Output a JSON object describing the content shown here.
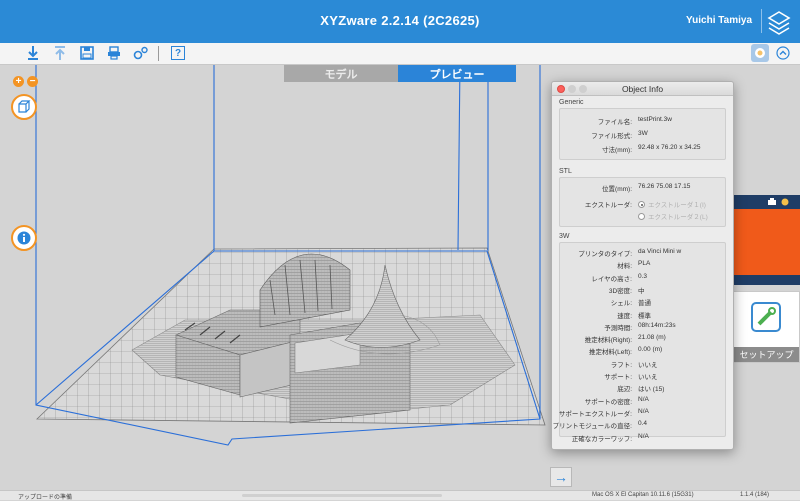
{
  "app": {
    "title": "XYZware 2.2.14 (2C2625)",
    "user_name": "Yuichi Tamiya"
  },
  "toolbar": {
    "buttons": [
      "import-icon",
      "export-icon",
      "save-icon",
      "print-icon",
      "settings-icon",
      "help-icon"
    ],
    "help_label": "?"
  },
  "colors": {
    "accent": "#2b8ad6",
    "orange": "#f39424",
    "panel_orange": "#f05a1a",
    "navy": "#1f3d66"
  },
  "mode_tabs": {
    "model": "モデル",
    "preview": "プレビュー",
    "active": "preview"
  },
  "zoom": {
    "plus": "+",
    "minus": "−"
  },
  "object_info": {
    "title": "Object Info",
    "generic": {
      "title": "Generic",
      "rows": [
        {
          "label": "ファイル名:",
          "value": "testPrint.3w"
        },
        {
          "label": "ファイル形式:",
          "value": "3W"
        },
        {
          "label": "寸法(mm):",
          "value": "92.48 x 76.20 x 34.25"
        }
      ]
    },
    "stl": {
      "title": "STL",
      "position_label": "位置(mm):",
      "position_value": "76.26  75.08  17.15",
      "extruder_label": "エクストルーダ:",
      "extruder_options": [
        "エクストルーダ１(I)",
        "エクストルーダ２(L)"
      ],
      "extruder_selected": 0
    },
    "w3": {
      "title": "3W",
      "rows": [
        {
          "label": "プリンタのタイプ:",
          "value": "da Vinci Mini w"
        },
        {
          "label": "材料:",
          "value": "PLA"
        },
        {
          "label": "レイヤの高さ:",
          "value": "0.3"
        },
        {
          "label": "3D密度:",
          "value": "中"
        },
        {
          "label": "シェル:",
          "value": "普通"
        },
        {
          "label": "速度:",
          "value": "標準"
        },
        {
          "label": "予測時間:",
          "value": "08h:14m:23s"
        },
        {
          "label": "推定材料(Right):",
          "value": "21.08 (m)"
        },
        {
          "label": "推定材料(Left):",
          "value": "0.00 (m)"
        },
        {
          "label": "ラフト:",
          "value": "いいえ"
        },
        {
          "label": "サポート:",
          "value": "いいえ"
        },
        {
          "label": "底辺:",
          "value": "はい (15)"
        },
        {
          "label": "サポートの密度:",
          "value": "N/A"
        },
        {
          "label": "サポートエクストルーダ:",
          "value": "N/A"
        },
        {
          "label": "プリントモジュールの直径:",
          "value": "0.4"
        },
        {
          "label": "正確なカラーワッフ:",
          "value": "N/A"
        }
      ]
    }
  },
  "right_panel": {
    "setup_label": "セットアップ"
  },
  "next_button": "→",
  "status": {
    "upload": "アップロードの準備",
    "os": "Mac OS X El Capitan 10.11.6 (15G31)",
    "version": "1.1.4 (184)"
  }
}
